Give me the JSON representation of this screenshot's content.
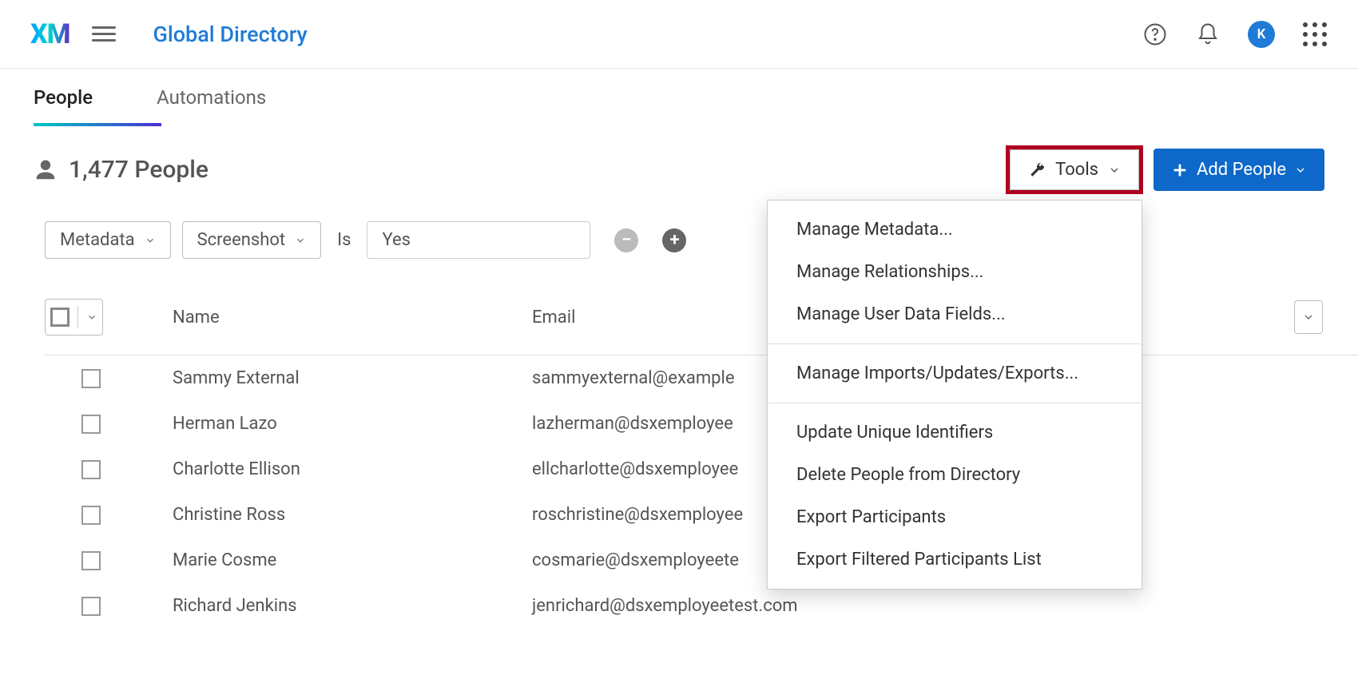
{
  "header": {
    "logo": "XM",
    "page_title": "Global Directory",
    "avatar_initial": "K"
  },
  "tabs": [
    {
      "label": "People",
      "active": true
    },
    {
      "label": "Automations",
      "active": false
    }
  ],
  "summary": {
    "count_label": "1,477 People",
    "tools_label": "Tools",
    "add_people_label": "Add People"
  },
  "filters": {
    "field_chip": "Metadata",
    "column_chip": "Screenshot",
    "operator": "Is",
    "value": "Yes"
  },
  "table": {
    "columns": {
      "name": "Name",
      "email": "Email"
    },
    "rows": [
      {
        "name": "Sammy External",
        "email": "sammyexternal@example"
      },
      {
        "name": "Herman Lazo",
        "email": "lazherman@dsxemployee"
      },
      {
        "name": "Charlotte Ellison",
        "email": "ellcharlotte@dsxemployee"
      },
      {
        "name": "Christine Ross",
        "email": "roschristine@dsxemployee"
      },
      {
        "name": "Marie Cosme",
        "email": "cosmarie@dsxemployeete"
      },
      {
        "name": "Richard Jenkins",
        "email": "jenrichard@dsxemployeetest.com"
      }
    ]
  },
  "tools_menu": {
    "sections": [
      {
        "items": [
          "Manage Metadata...",
          "Manage Relationships...",
          "Manage User Data Fields..."
        ]
      },
      {
        "items": [
          "Manage Imports/Updates/Exports..."
        ]
      },
      {
        "items": [
          "Update Unique Identifiers",
          "Delete People from Directory",
          "Export Participants",
          "Export Filtered Participants List"
        ]
      }
    ]
  }
}
